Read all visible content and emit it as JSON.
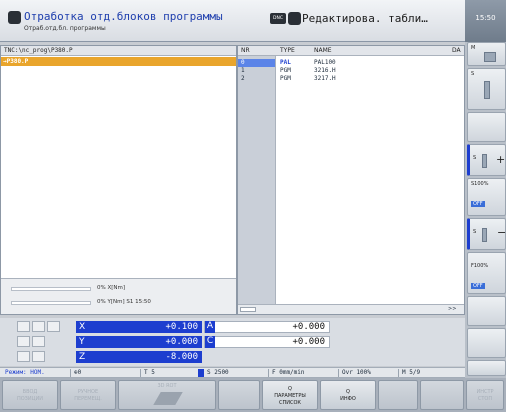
{
  "header": {
    "left_title": "Отработка отд.блоков программы",
    "left_subtitle": "Отраб.отд.бл. программы",
    "dnc_label": "DNC",
    "right_title": "Редактирова. табли…",
    "clock": "15:50"
  },
  "tree": {
    "path": "TNC:\\nc_prog\\P380.P",
    "selected": "→P380.P"
  },
  "info": {
    "line1_value": "0% X[Nm]",
    "line2_value": "0% Y[Nm] S1  15:50"
  },
  "table": {
    "columns": [
      "NR",
      "TYPE",
      "NAME",
      "DA"
    ],
    "rows": [
      {
        "nr": "0",
        "type": "PAL",
        "name": "PAL100"
      },
      {
        "nr": "1",
        "type": "PGM",
        "name": "3216.H"
      },
      {
        "nr": "2",
        "type": "PGM",
        "name": "3217.H"
      }
    ],
    "scroll_next": ">>"
  },
  "positions": {
    "left": [
      {
        "axis": "X",
        "value": "+0.100"
      },
      {
        "axis": "Y",
        "value": "+0.000"
      },
      {
        "axis": "Z",
        "value": "-8.000"
      }
    ],
    "right": [
      {
        "axis": "A",
        "value": "+0.000"
      },
      {
        "axis": "C",
        "value": "+0.000"
      }
    ]
  },
  "status_bar": {
    "mode": "Режим: НОМ.",
    "preset": "0",
    "tool": "T 5",
    "spindle": "S 2500",
    "feed": "F 0mm/min",
    "override": "Ovr 100%",
    "m_func": "M 5/9"
  },
  "side_softkeys": {
    "m_label": "M",
    "s_label": "S",
    "s_plus": "S",
    "s_pct": "S100%",
    "s_off": "OFF",
    "s_minus": "S",
    "f_pct": "F100%",
    "f_off": "OFF"
  },
  "softkeys": [
    {
      "label": "ВВОД\nПОЗИЦИИ",
      "enabled": false
    },
    {
      "label": "РУЧНОЕ\nПЕРЕМЕЩ.",
      "enabled": false
    },
    {
      "label": "3D ROT",
      "enabled": false
    },
    {
      "label": "",
      "enabled": false
    },
    {
      "label": "Q\nПАРАМЕТРЫ\nСПИСОК",
      "enabled": true
    },
    {
      "label": "Q\nИНФО",
      "enabled": true
    },
    {
      "label": "",
      "enabled": false
    },
    {
      "label": "",
      "enabled": false
    },
    {
      "label": "ИНСТР\nСТОП",
      "enabled": false
    }
  ],
  "colors": {
    "accent_blue": "#1d3ecf",
    "selection_orange": "#e9a52c",
    "status_off_blue": "#3a6ed8"
  }
}
